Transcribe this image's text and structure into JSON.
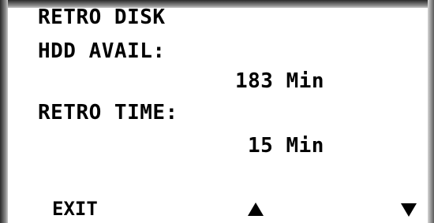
{
  "screen": {
    "title": "RETRO DISK",
    "hdd_avail_label": "HDD AVAIL:",
    "hdd_avail_value": "183 Min",
    "retro_time_label": "RETRO TIME:",
    "retro_time_value": "15 Min"
  },
  "softkeys": {
    "exit_label": "EXIT",
    "up_icon": "triangle-up-icon",
    "down_icon": "triangle-down-icon"
  },
  "colors": {
    "text": "#000000",
    "background": "#ffffff",
    "bezel": "#8a8a8a"
  }
}
